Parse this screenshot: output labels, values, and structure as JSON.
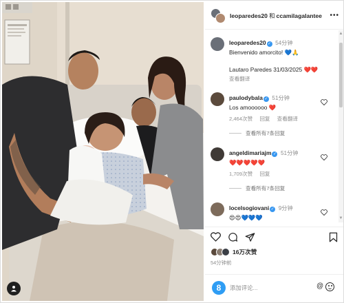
{
  "post": {
    "author_primary": "leoparedes20",
    "conjunction": "和",
    "author_secondary": "ccamilagalantee",
    "more_label": "•••"
  },
  "caption": {
    "user": "leoparedes20",
    "time": "54分钟",
    "line1": "Bienvenido amorcito! 💙🙏",
    "line2": "Lautaro Paredes 31/03/2025 ❤️❤️",
    "translate": "查看翻译"
  },
  "comments": [
    {
      "user": "paulodybala",
      "time": "51分钟",
      "text": "Los amoooooo ❤️",
      "likes": "2,464次赞",
      "reply": "回复",
      "translate": "查看翻译",
      "replies": "查看所有7条回复",
      "avatar_color": "#5b4a3c"
    },
    {
      "user": "angeldimariajm",
      "time": "51分钟",
      "text": "❤️❤️❤️❤️❤️",
      "likes": "1,709次赞",
      "reply": "回复",
      "replies": "查看所有7条回复",
      "avatar_color": "#3f3a36"
    },
    {
      "user": "locelsogiovani",
      "time": "9分钟",
      "text": "😍😍💙💙💙",
      "avatar_color": "#7d6b5b"
    }
  ],
  "actions": {
    "like_icon": "heart-icon",
    "comment_icon": "comment-icon",
    "share_icon": "send-icon",
    "save_icon": "bookmark-icon"
  },
  "likes": {
    "count": "16万次赞"
  },
  "posted_ago": "54分钟前",
  "add_comment": {
    "placeholder": "添加评论...",
    "logo_text": "8",
    "mention_icon": "@"
  },
  "colors": {
    "verified": "#3897f0",
    "red_heart": "#ed2b3b",
    "blue_heart": "#2b8ae0"
  }
}
